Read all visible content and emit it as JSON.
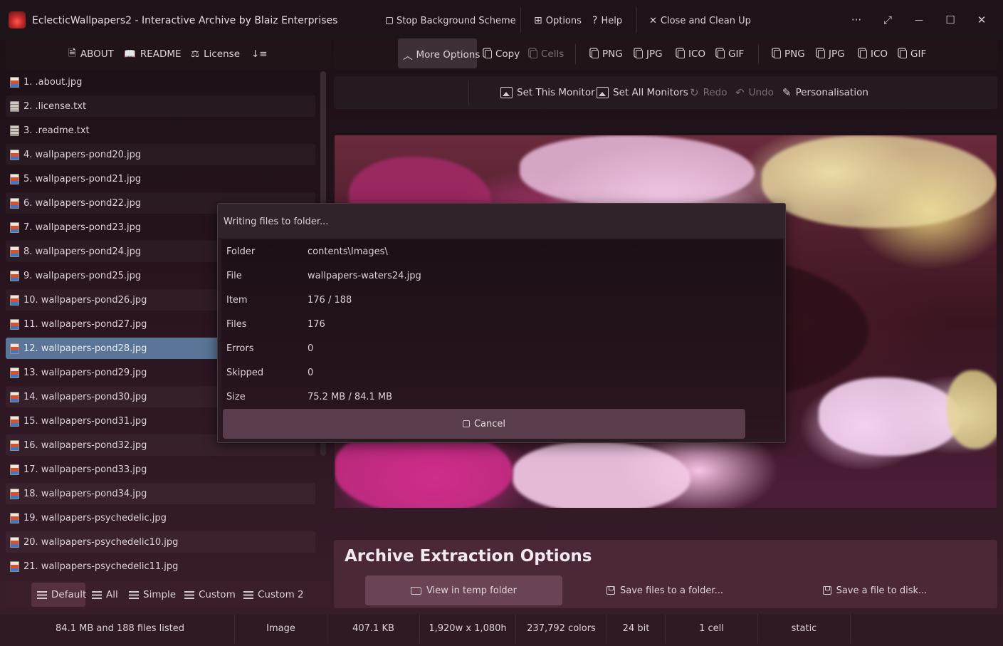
{
  "window": {
    "title": "EclecticWallpapers2  -  Interactive Archive by Blaiz Enterprises",
    "actions": {
      "stop_bg": "Stop Background Scheme",
      "options": "Options",
      "help": "Help",
      "close_clean": "Close and Clean Up"
    },
    "controls": {
      "more": "···",
      "expand": "⤢",
      "minimize": "—",
      "maximize": "☐",
      "close": "✕"
    }
  },
  "left_toolbar": {
    "about": "ABOUT",
    "readme": "README",
    "license": "License",
    "sort": "↓≡"
  },
  "files": [
    {
      "label": "1. .about.jpg",
      "type": "img"
    },
    {
      "label": "2. .license.txt",
      "type": "txt"
    },
    {
      "label": "3. .readme.txt",
      "type": "txt"
    },
    {
      "label": "4. wallpapers-pond20.jpg",
      "type": "img"
    },
    {
      "label": "5. wallpapers-pond21.jpg",
      "type": "img"
    },
    {
      "label": "6. wallpapers-pond22.jpg",
      "type": "img"
    },
    {
      "label": "7. wallpapers-pond23.jpg",
      "type": "img"
    },
    {
      "label": "8. wallpapers-pond24.jpg",
      "type": "img"
    },
    {
      "label": "9. wallpapers-pond25.jpg",
      "type": "img"
    },
    {
      "label": "10. wallpapers-pond26.jpg",
      "type": "img"
    },
    {
      "label": "11. wallpapers-pond27.jpg",
      "type": "img"
    },
    {
      "label": "12. wallpapers-pond28.jpg",
      "type": "img",
      "selected": true
    },
    {
      "label": "13. wallpapers-pond29.jpg",
      "type": "img"
    },
    {
      "label": "14. wallpapers-pond30.jpg",
      "type": "img"
    },
    {
      "label": "15. wallpapers-pond31.jpg",
      "type": "img"
    },
    {
      "label": "16. wallpapers-pond32.jpg",
      "type": "img"
    },
    {
      "label": "17. wallpapers-pond33.jpg",
      "type": "img"
    },
    {
      "label": "18. wallpapers-pond34.jpg",
      "type": "img"
    },
    {
      "label": "19. wallpapers-psychedelic.jpg",
      "type": "img"
    },
    {
      "label": "20. wallpapers-psychedelic10.jpg",
      "type": "img"
    },
    {
      "label": "21. wallpapers-psychedelic11.jpg",
      "type": "img"
    }
  ],
  "view_modes": {
    "default": "Default",
    "all": "All",
    "simple": "Simple",
    "custom": "Custom",
    "custom2": "Custom 2"
  },
  "right_toolbar": {
    "more_options": "More Options",
    "copy": "Copy",
    "cells": "Cells",
    "formats_a": [
      "PNG",
      "JPG",
      "ICO",
      "GIF"
    ],
    "formats_b": [
      "PNG",
      "JPG",
      "ICO",
      "GIF"
    ]
  },
  "monitor_bar": {
    "set_this": "Set This Monitor",
    "set_all": "Set All Monitors",
    "redo": "Redo",
    "undo": "Undo",
    "personalisation": "Personalisation"
  },
  "archive": {
    "title": "Archive Extraction Options",
    "view_temp": "View in temp folder",
    "save_folder": "Save files to a folder...",
    "save_file": "Save a file to disk..."
  },
  "status": {
    "listed": "84.1 MB and 188 files listed",
    "kind": "Image",
    "size": "407.1 KB",
    "dims": "1,920w x 1,080h",
    "colors": "237,792 colors",
    "depth": "24 bit",
    "cells": "1 cell",
    "mode": "static"
  },
  "dialog": {
    "title": "Writing files to folder...",
    "rows": [
      {
        "label": "Folder",
        "value": "contents\\Images\\"
      },
      {
        "label": "File",
        "value": "wallpapers-waters24.jpg"
      },
      {
        "label": "Item",
        "value": "176 / 188"
      },
      {
        "label": "Files",
        "value": "176"
      },
      {
        "label": "Errors",
        "value": "0"
      },
      {
        "label": "Skipped",
        "value": "0"
      },
      {
        "label": "Size",
        "value": "75.2 MB / 84.1 MB"
      }
    ],
    "cancel": "Cancel"
  }
}
